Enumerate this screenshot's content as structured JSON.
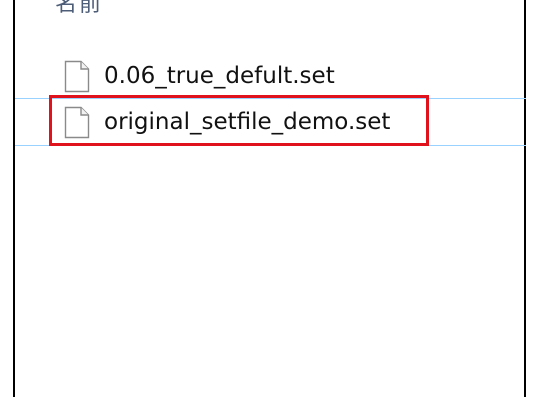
{
  "list": {
    "column_header": "名前",
    "files": [
      {
        "name": "0.06_true_defult.set",
        "icon": "file-icon"
      },
      {
        "name": "original_setfile_demo.set",
        "icon": "file-icon",
        "selected": true
      }
    ]
  },
  "colors": {
    "highlight": "#e0121c",
    "selection_line": "#99d1ff",
    "header_text": "#4d5d77"
  }
}
